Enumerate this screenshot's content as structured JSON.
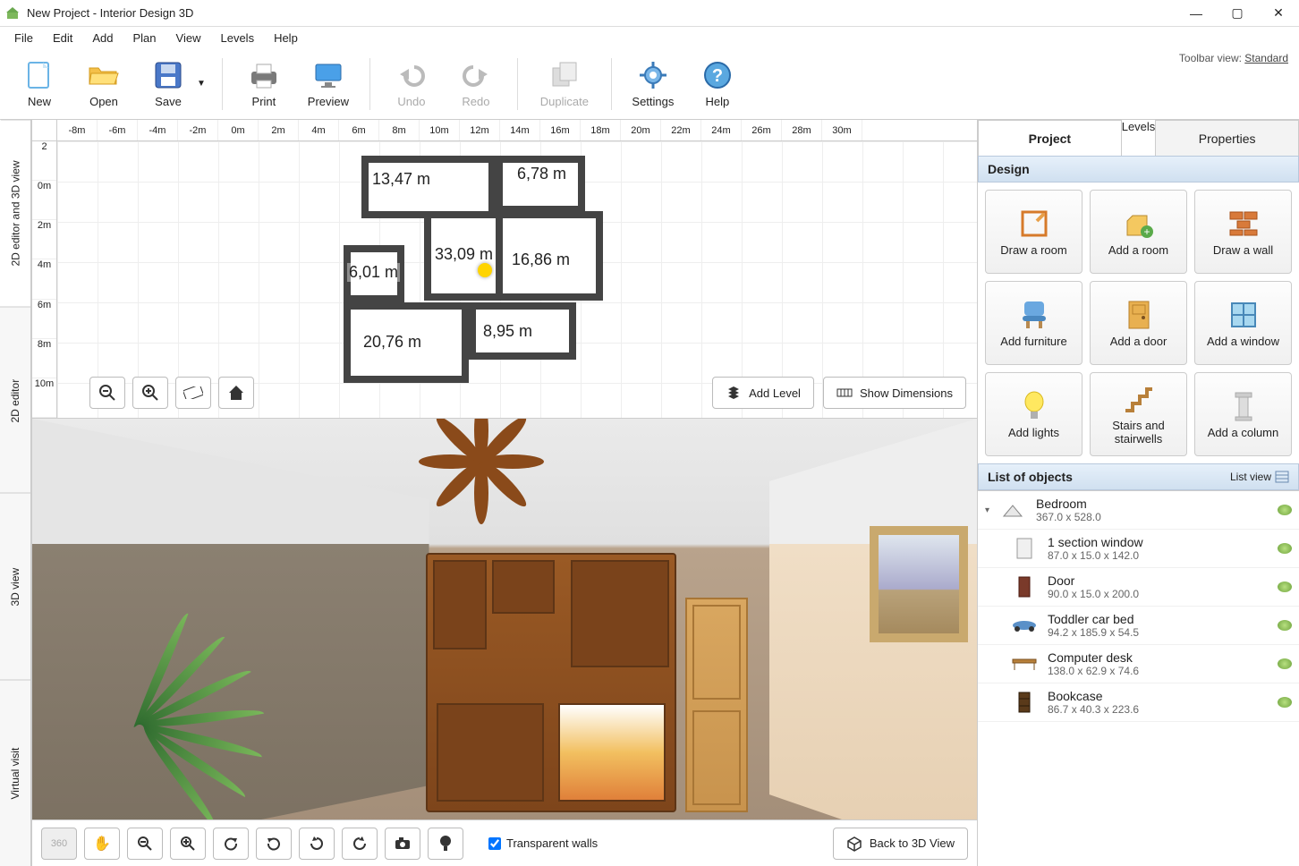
{
  "titlebar": {
    "title": "New Project - Interior Design 3D"
  },
  "menu": [
    "File",
    "Edit",
    "Add",
    "Plan",
    "View",
    "Levels",
    "Help"
  ],
  "toolbar": {
    "new": "New",
    "open": "Open",
    "save": "Save",
    "print": "Print",
    "preview": "Preview",
    "undo": "Undo",
    "redo": "Redo",
    "duplicate": "Duplicate",
    "settings": "Settings",
    "help": "Help",
    "toolbar_view_label": "Toolbar view: ",
    "toolbar_view_value": "Standard"
  },
  "vtabs": {
    "v2d3d": "2D editor and 3D view",
    "v2d": "2D editor",
    "v3d": "3D view",
    "visit": "Virtual visit"
  },
  "ruler_top": [
    "-8m",
    "-6m",
    "-4m",
    "-2m",
    "0m",
    "2m",
    "4m",
    "6m",
    "8m",
    "10m",
    "12m",
    "14m",
    "16m",
    "18m",
    "20m",
    "22m",
    "24m",
    "26m",
    "28m",
    "30m"
  ],
  "ruler_left": [
    "2",
    "0m",
    "2m",
    "4m",
    "6m",
    "8m",
    "10m"
  ],
  "floorplan_rooms": {
    "r1": "13,47 m",
    "r2": "6,78 m",
    "r3": "33,09 m",
    "r4": "6,01 m",
    "r5": "16,86 m",
    "r6": "20,76 m",
    "r7": "8,95 m"
  },
  "plan_buttons": {
    "add_level": "Add Level",
    "show_dimensions": "Show Dimensions"
  },
  "view3d_bottom": {
    "transparent_walls": "Transparent walls",
    "back_to_3d": "Back to 3D View"
  },
  "right_tabs": {
    "project": "Project",
    "levels": "Levels",
    "properties": "Properties"
  },
  "design_header": "Design",
  "design_buttons": [
    "Draw a room",
    "Add a room",
    "Draw a wall",
    "Add furniture",
    "Add a door",
    "Add a window",
    "Add lights",
    "Stairs and stairwells",
    "Add a column"
  ],
  "list_header": {
    "title": "List of objects",
    "view_label": "List view"
  },
  "objects": [
    {
      "name": "Bedroom",
      "dims": "367.0 x 528.0",
      "child": false
    },
    {
      "name": "1 section window",
      "dims": "87.0 x 15.0 x 142.0",
      "child": true
    },
    {
      "name": "Door",
      "dims": "90.0 x 15.0 x 200.0",
      "child": true
    },
    {
      "name": "Toddler car bed",
      "dims": "94.2 x 185.9 x 54.5",
      "child": true
    },
    {
      "name": "Computer desk",
      "dims": "138.0 x 62.9 x 74.6",
      "child": true
    },
    {
      "name": "Bookcase",
      "dims": "86.7 x 40.3 x 223.6",
      "child": true
    }
  ]
}
